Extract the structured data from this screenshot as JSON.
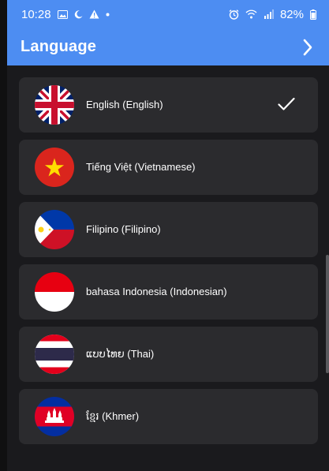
{
  "status_bar": {
    "time": "10:28",
    "battery": "82%",
    "left_icons": [
      "image-icon",
      "moon-icon",
      "warning-icon",
      "dot-icon"
    ],
    "right_icons": [
      "alarm-icon",
      "wifi-icon",
      "signal-icon",
      "battery-icon"
    ]
  },
  "app_bar": {
    "title": "Language",
    "action_icon": "chevron-right-icon",
    "background": "#4d8df2"
  },
  "languages": [
    {
      "label": "English (English)",
      "flag": "flag-uk-icon",
      "selected": true
    },
    {
      "label": "Tiếng Việt (Vietnamese)",
      "flag": "flag-vietnam-icon",
      "selected": false
    },
    {
      "label": "Filipino (Filipino)",
      "flag": "flag-philippines-icon",
      "selected": false
    },
    {
      "label": "bahasa Indonesia (Indonesian)",
      "flag": "flag-indonesia-icon",
      "selected": false
    },
    {
      "label": "ແບບໄທຍ (Thai)",
      "flag": "flag-thailand-icon",
      "selected": false
    },
    {
      "label": "ខ្មែរ (Khmer)",
      "flag": "flag-cambodia-icon",
      "selected": false
    }
  ],
  "colors": {
    "background": "#1a1a1d",
    "card": "#2b2b2e",
    "text": "#ffffff"
  }
}
